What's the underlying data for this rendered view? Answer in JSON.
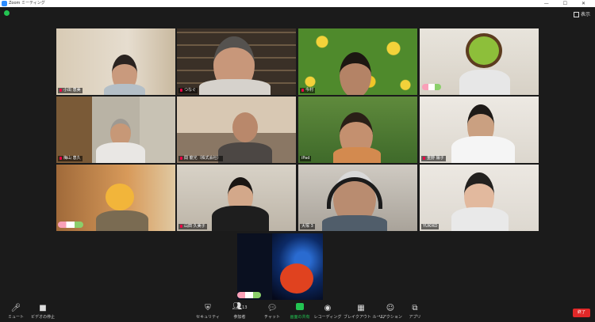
{
  "window": {
    "title": "Zoom ミーティング",
    "controls": "— ☐ ✕"
  },
  "view_button": {
    "label": "表示"
  },
  "participants": [
    {
      "name": "小出 恵美"
    },
    {
      "name": "つなぐ"
    },
    {
      "name": "今村"
    },
    {
      "name": ""
    },
    {
      "name": "梅山 恵久"
    },
    {
      "name": "間 龍光（株式会社）"
    },
    {
      "name": "iPad"
    },
    {
      "name": "重野 陽子"
    },
    {
      "name": ""
    },
    {
      "name": "山田 久美子"
    },
    {
      "name": "大塚 3"
    },
    {
      "name": "YUKIKO"
    },
    {
      "name": ""
    }
  ],
  "toolbar": {
    "mute": "ミュート",
    "video": "ビデオの停止",
    "security": "セキュリティ",
    "participants": "参加者",
    "participants_count": "13",
    "chat": "チャット",
    "share": "画面の共有",
    "record": "レコーディング",
    "breakout": "ブレイクアウト ルーム",
    "reactions": "リアクション",
    "apps": "アプリ",
    "end": "終了"
  }
}
